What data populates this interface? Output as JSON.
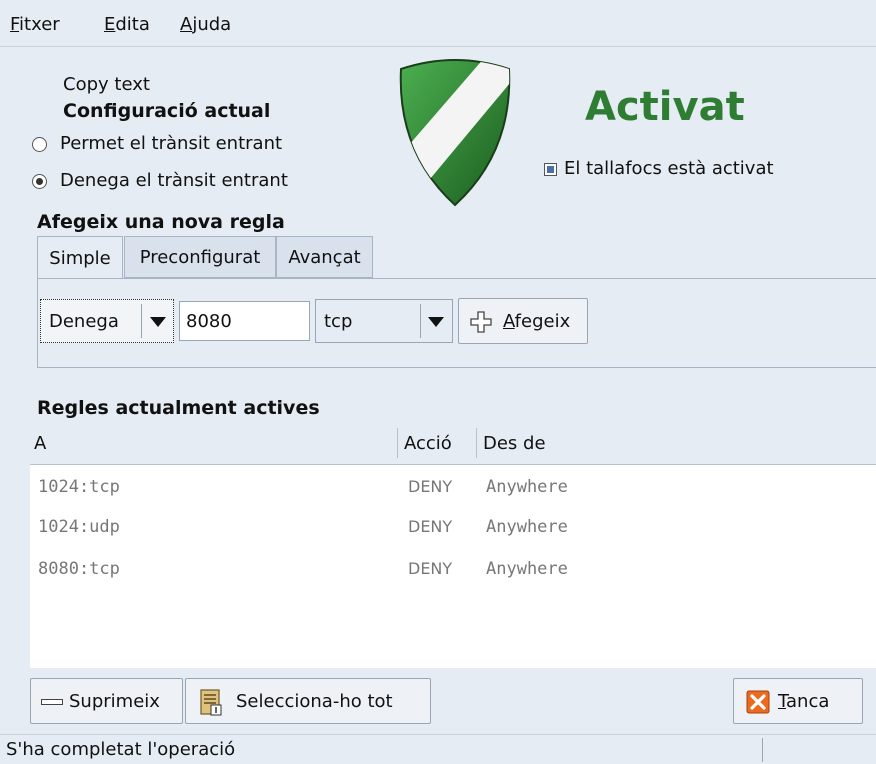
{
  "menubar": {
    "items": [
      {
        "label": "Fitxer",
        "mnemonic": "F",
        "rest": "itxer"
      },
      {
        "label": "Edita",
        "mnemonic": "E",
        "rest": "dita"
      },
      {
        "label": "Ajuda",
        "mnemonic": "A",
        "rest": "juda"
      }
    ]
  },
  "config": {
    "copy_text": "Copy text",
    "heading": "Configuració actual",
    "options": [
      {
        "label": "Permet el trànsit entrant",
        "checked": false
      },
      {
        "label": "Denega el trànsit entrant",
        "checked": true
      }
    ]
  },
  "status_panel": {
    "title": "Activat",
    "title_color": "#2e7d32",
    "checkbox_label": "El tallafocs està activat"
  },
  "new_rule": {
    "heading": "Afegeix una nova regla",
    "tabs": [
      {
        "label": "Simple",
        "active": true
      },
      {
        "label": "Preconfigurat",
        "active": false
      },
      {
        "label": "Avançat",
        "active": false
      }
    ],
    "action_value": "Denega",
    "port_value": "8080",
    "protocol_value": "tcp",
    "add_button": {
      "mnemonic": "A",
      "rest": "fegeix"
    }
  },
  "rules": {
    "heading": "Regles actualment actives",
    "columns": [
      "A",
      "Acció",
      "Des de"
    ],
    "rows": [
      {
        "to": "1024:tcp",
        "action": "DENY",
        "from": "Anywhere"
      },
      {
        "to": "1024:udp",
        "action": "DENY",
        "from": "Anywhere"
      },
      {
        "to": "8080:tcp",
        "action": "DENY",
        "from": "Anywhere"
      }
    ]
  },
  "buttons": {
    "remove": "Suprimeix",
    "select_all": "Selecciona-ho tot",
    "close": {
      "mnemonic": "T",
      "rest": "anca"
    }
  },
  "statusbar": {
    "text": "S'ha completat l'operació"
  }
}
